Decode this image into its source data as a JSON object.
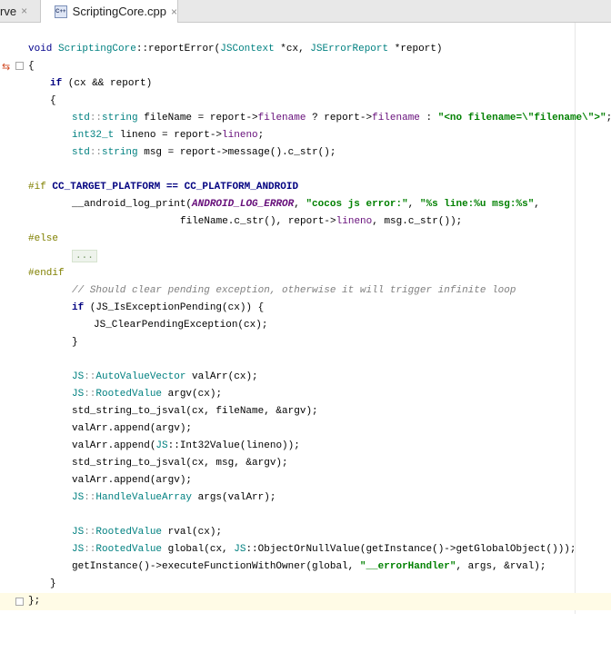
{
  "tabs": [
    {
      "label": "rve",
      "close": "×"
    },
    {
      "label": "ScriptingCore.cpp",
      "close": "×",
      "icon": "C++"
    }
  ],
  "code": {
    "l1": [
      "void ",
      "ScriptingCore",
      "::reportError(",
      "JSContext",
      " *cx, ",
      "JSErrorReport",
      " *report)"
    ],
    "l2": "{",
    "l3": [
      "if",
      " (cx && report)"
    ],
    "l4": "{",
    "l5": [
      "std",
      "::",
      "string",
      " fileName = report->",
      "filename",
      " ? report->",
      "filename",
      " : ",
      "\"<no filename=\\\"filename\\\">\"",
      ";"
    ],
    "l6": [
      "int32_t",
      " lineno = report->",
      "lineno",
      ";"
    ],
    "l7": [
      "std",
      "::",
      "string",
      " msg = report->",
      "message().c_str();"
    ],
    "l8": [
      "#if ",
      "CC_TARGET_PLATFORM == CC_PLATFORM_ANDROID"
    ],
    "l9": [
      "__android_log_print(",
      "ANDROID_LOG_ERROR",
      ", ",
      "\"cocos js error:\"",
      ", ",
      "\"%s line:%u msg:%s\"",
      ","
    ],
    "l10": [
      "fileName.c_str(), report->",
      "lineno",
      ", msg.c_str());"
    ],
    "l11": "#else",
    "l12": "...",
    "l13": "#endif",
    "l14": "// Should clear pending exception, otherwise it will trigger infinite loop",
    "l15": [
      "if",
      " (JS_IsExceptionPending(cx)) {"
    ],
    "l16": "JS_ClearPendingException(cx);",
    "l17": "}",
    "l18": [
      "JS",
      "::",
      "AutoValueVector",
      " valArr(cx);"
    ],
    "l19": [
      "JS",
      "::",
      "RootedValue",
      " argv(cx);"
    ],
    "l20": "std_string_to_jsval(cx, fileName, &argv);",
    "l21": "valArr.append(argv);",
    "l22": [
      "valArr.append(",
      "JS",
      "::Int32Value(lineno));"
    ],
    "l23": "std_string_to_jsval(cx, msg, &argv);",
    "l24": "valArr.append(argv);",
    "l25": [
      "JS",
      "::",
      "HandleValueArray",
      " args(valArr);"
    ],
    "l26": [
      "JS",
      "::",
      "RootedValue",
      " rval(cx);"
    ],
    "l27": [
      "JS",
      "::",
      "RootedValue",
      " global(cx, ",
      "JS",
      "::ObjectOrNullValue(getInstance()->getGlobalObject()));"
    ],
    "l28": [
      "getInstance()->executeFunctionWithOwner(global, ",
      "\"__errorHandler\"",
      ", args, &rval);"
    ],
    "l29": "}",
    "l30": "};"
  },
  "colors": {
    "keyword": "#000080",
    "string": "#008000",
    "comment": "#808080",
    "namespace": "#008080",
    "field": "#660e7a",
    "preprocessor": "#808000"
  }
}
